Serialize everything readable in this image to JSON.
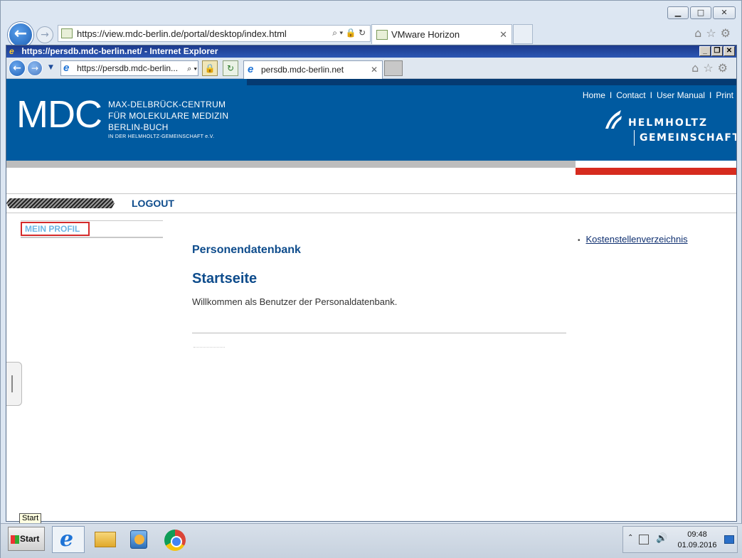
{
  "outer_browser": {
    "url": "https://view.mdc-berlin.de/portal/desktop/index.html",
    "tab_title": "VMware Horizon"
  },
  "inner_browser": {
    "window_title": "https://persdb.mdc-berlin.net/ - Internet Explorer",
    "url": "https://persdb.mdc-berlin...",
    "tab_title": "persdb.mdc-berlin.net"
  },
  "site": {
    "logo": "MDC",
    "org_lines": [
      "MAX-DELBRÜCK-CENTRUM",
      "FÜR MOLEKULARE MEDIZIN",
      "BERLIN-BUCH",
      "IN DER HELMHOLTZ-GEMEINSCHAFT e.V."
    ],
    "top_links": [
      "Home",
      "Contact",
      "User Manual",
      "Print"
    ],
    "top_link_separator": "I",
    "helmholtz_line1": "HELMHOLTZ",
    "helmholtz_line2": "GEMEINSCHAFT",
    "logout": "LOGOUT",
    "left_nav": [
      "MEIN PROFIL"
    ],
    "section_title": "Personendatenbank",
    "page_heading": "Startseite",
    "welcome_text": "Willkommen als Benutzer der Personaldatenbank.",
    "right_links": [
      "Kostenstellenverzeichnis"
    ]
  },
  "taskbar": {
    "start_label": "Start",
    "start_tooltip": "Start",
    "time": "09:48",
    "date": "01.09.2016"
  },
  "colors": {
    "banner_blue": "#005aa0",
    "accent_red": "#d62b1f",
    "heading_blue": "#0e4c8c"
  }
}
